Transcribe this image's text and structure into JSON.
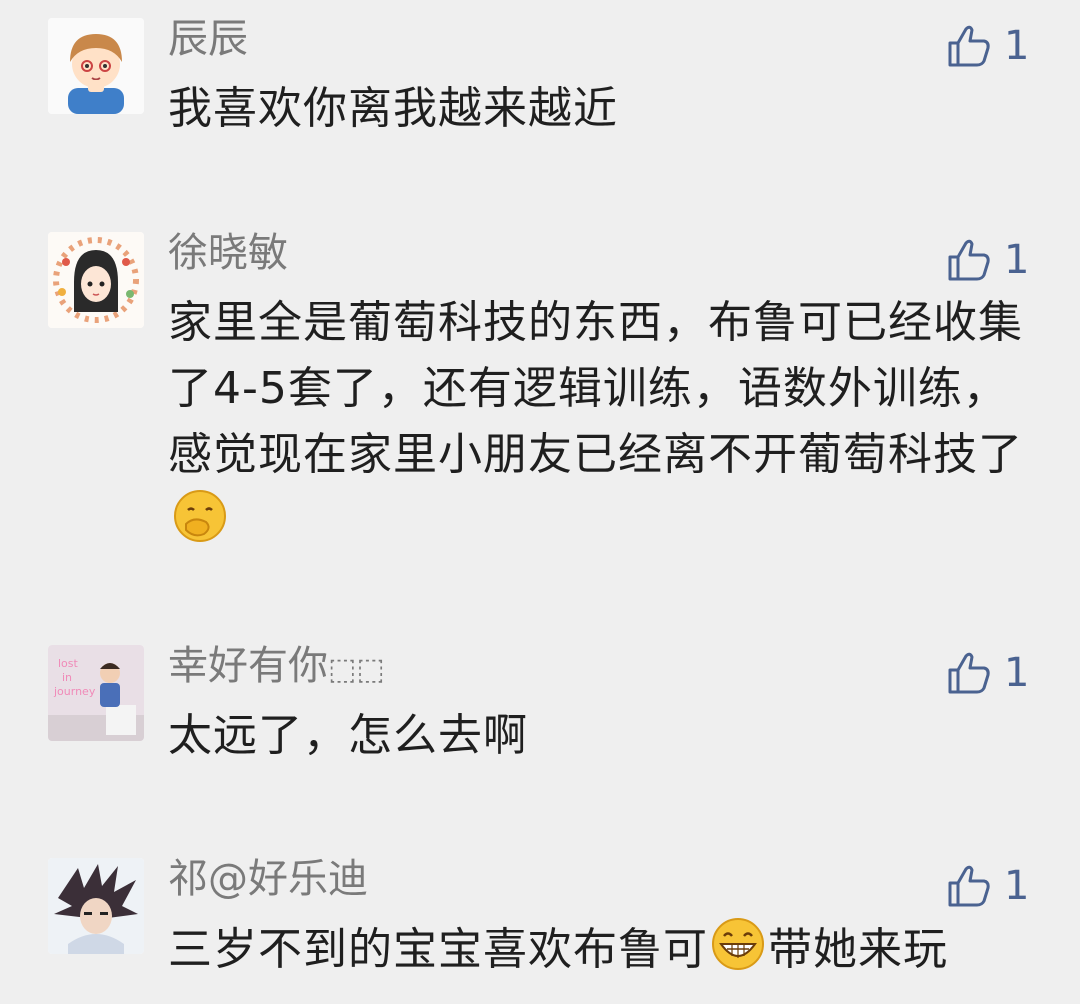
{
  "colors": {
    "background": "#efefef",
    "author": "#7a7a7a",
    "text": "#1f1f1f",
    "like": "#4a6290"
  },
  "comments": [
    {
      "author": "辰辰",
      "text": "我喜欢你离我越来越近",
      "likes": "1",
      "avatar_icon": "cartoon-boy-avatar"
    },
    {
      "author": "徐晓敏",
      "text": "家里全是葡萄科技的东西，布鲁可已经收集了4-5套了，还有逻辑训练，语数外训练，感觉现在家里小朋友已经离不开葡萄科技了",
      "emoji": "hand-over-mouth-emoji",
      "likes": "1",
      "avatar_icon": "cartoon-girl-flower-wreath-avatar"
    },
    {
      "author": "幸好有你",
      "author_suffix": "⬚⬚",
      "text": "太远了，怎么去啊",
      "likes": "1",
      "avatar_icon": "child-photo-avatar",
      "avatar_text": [
        "lost",
        "in",
        "journey"
      ]
    },
    {
      "author": "祁@好乐迪",
      "text_before": "三岁不到的宝宝喜欢布鲁可",
      "emoji": "grinning-emoji",
      "text_after": "带她来玩",
      "likes": "1",
      "avatar_icon": "anime-character-avatar"
    }
  ]
}
